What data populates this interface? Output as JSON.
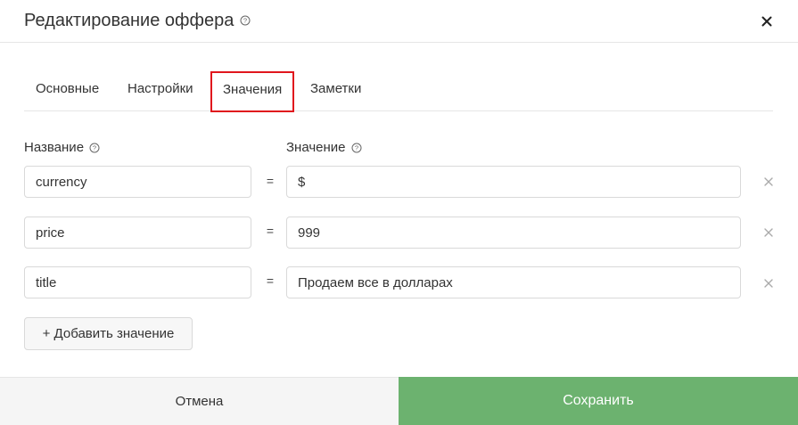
{
  "dialog": {
    "title": "Редактирование оффера",
    "tabs": [
      {
        "label": "Основные"
      },
      {
        "label": "Настройки"
      },
      {
        "label": "Значения",
        "active": true
      },
      {
        "label": "Заметки"
      }
    ],
    "columns": {
      "name_label": "Название",
      "value_label": "Значение"
    },
    "rows": [
      {
        "name": "currency",
        "value": "$"
      },
      {
        "name": "price",
        "value": "999"
      },
      {
        "name": "title",
        "value": "Продаем все в долларах"
      }
    ],
    "equals_sign": "=",
    "add_button_label": "+ Добавить значение",
    "cancel_label": "Отмена",
    "save_label": "Сохранить"
  },
  "colors": {
    "accent_highlight": "#e0161d",
    "save_button": "#6cb26f"
  }
}
